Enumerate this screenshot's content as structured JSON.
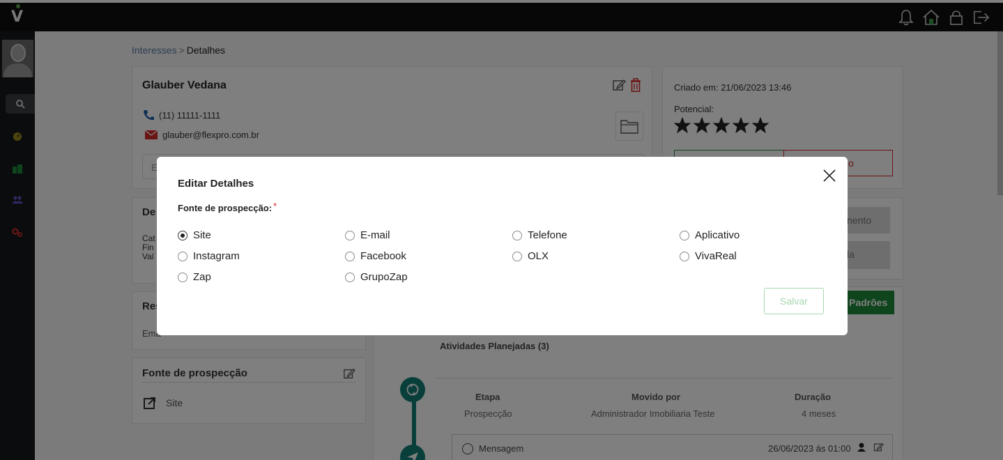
{
  "app": {
    "logo_text": "V"
  },
  "breadcrumb": {
    "parent": "Interesses",
    "separator": ">",
    "current": "Detalhes"
  },
  "contact": {
    "name": "Glauber Vedana",
    "phone": "(11) 11111-1111",
    "email": "glauber@flexpro.com.br",
    "field_fragment": "E"
  },
  "meta": {
    "created_label": "Criado em: 21/06/2023 13:46",
    "potential_label": "Potencial:",
    "stars_count": 5,
    "stars_max": 5,
    "red_button_fragment": "o"
  },
  "left_cards": {
    "details_title_fragment": "De",
    "details_lines": [
      "Cat",
      "Fin",
      "Val"
    ],
    "resp_title_fragment": "Res",
    "resp_line_fragment": "Ema",
    "source_title": "Fonte de prospecção",
    "source_value": "Site"
  },
  "right_buttons": {
    "gray1_fragment": "nento",
    "gray2_fragment": "la",
    "green_fragment": "Padrões"
  },
  "activities": {
    "title": "Atividades Planejadas (3)",
    "columns": [
      "Etapa",
      "Movido por",
      "Duração"
    ],
    "row": [
      "Prospecção",
      "Administrador Imobiliaria Teste",
      "4 meses"
    ],
    "message_label": "Mensagem",
    "message_time": "26/06/2023 ás 01:00"
  },
  "modal": {
    "title": "Editar Detalhes",
    "field_label": "Fonte de prospecção:",
    "required_mark": "*",
    "options": [
      "Site",
      "E-mail",
      "Telefone",
      "Aplicativo",
      "Instagram",
      "Facebook",
      "OLX",
      "VivaReal",
      "Zap",
      "GrupoZap"
    ],
    "selected": "Site",
    "save_label": "Salvar"
  },
  "colors": {
    "topbar": "#0e0f11",
    "accent_green": "#1f8a3b",
    "teal": "#127e77",
    "link_blue": "#5b7fa6",
    "danger_red": "#d62828"
  }
}
